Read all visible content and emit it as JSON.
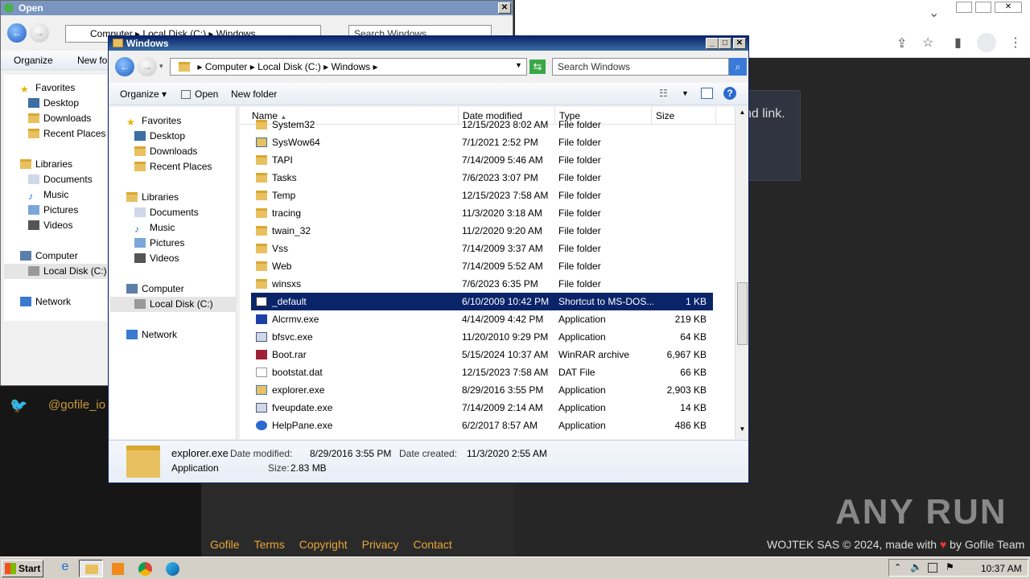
{
  "browser": {
    "partial_text": "nd link.",
    "social_handle": "@gofile_io",
    "footer_links": [
      "Gofile",
      "Terms",
      "Copyright",
      "Privacy",
      "Contact"
    ],
    "footer_right": "WOJTEK SAS © 2024, made with",
    "footer_by": "by Gofile Team",
    "watermark": "ANY RUN"
  },
  "open_dialog": {
    "title": "Open",
    "breadcrumb": [
      "Computer",
      "Local Disk (C:)",
      "Windows"
    ],
    "search_placeholder": "Search Windows",
    "organize": "Organize",
    "new_folder": "New fol",
    "nav": {
      "favorites": "Favorites",
      "fav_items": [
        "Desktop",
        "Downloads",
        "Recent Places"
      ],
      "libraries": "Libraries",
      "lib_items": [
        "Documents",
        "Music",
        "Pictures",
        "Videos"
      ],
      "computer": "Computer",
      "local_disk": "Local Disk (C:)",
      "network": "Network"
    }
  },
  "explorer": {
    "title": "Windows",
    "breadcrumb": [
      "Computer",
      "Local Disk (C:)",
      "Windows"
    ],
    "search_placeholder": "Search Windows",
    "toolbar": {
      "organize": "Organize",
      "open": "Open",
      "new_folder": "New folder"
    },
    "nav": {
      "favorites": "Favorites",
      "fav_items": [
        "Desktop",
        "Downloads",
        "Recent Places"
      ],
      "libraries": "Libraries",
      "lib_items": [
        "Documents",
        "Music",
        "Pictures",
        "Videos"
      ],
      "computer": "Computer",
      "local_disk": "Local Disk (C:)",
      "network": "Network"
    },
    "columns": [
      "Name",
      "Date modified",
      "Type",
      "Size"
    ],
    "rows": [
      {
        "name": "System32",
        "date": "12/15/2023 8:02 AM",
        "type": "File folder",
        "size": "",
        "icon": "folder"
      },
      {
        "name": "SysWow64",
        "date": "7/1/2021 2:52 PM",
        "type": "File folder",
        "size": "",
        "icon": "folder-link"
      },
      {
        "name": "TAPI",
        "date": "7/14/2009 5:46 AM",
        "type": "File folder",
        "size": "",
        "icon": "folder"
      },
      {
        "name": "Tasks",
        "date": "7/6/2023 3:07 PM",
        "type": "File folder",
        "size": "",
        "icon": "folder"
      },
      {
        "name": "Temp",
        "date": "12/15/2023 7:58 AM",
        "type": "File folder",
        "size": "",
        "icon": "folder"
      },
      {
        "name": "tracing",
        "date": "11/3/2020 3:18 AM",
        "type": "File folder",
        "size": "",
        "icon": "folder"
      },
      {
        "name": "twain_32",
        "date": "11/2/2020 9:20 AM",
        "type": "File folder",
        "size": "",
        "icon": "folder"
      },
      {
        "name": "Vss",
        "date": "7/14/2009 3:37 AM",
        "type": "File folder",
        "size": "",
        "icon": "folder"
      },
      {
        "name": "Web",
        "date": "7/14/2009 5:52 AM",
        "type": "File folder",
        "size": "",
        "icon": "folder"
      },
      {
        "name": "winsxs",
        "date": "7/6/2023 6:35 PM",
        "type": "File folder",
        "size": "",
        "icon": "folder"
      },
      {
        "name": "_default",
        "date": "6/10/2009 10:42 PM",
        "type": "Shortcut to MS-DOS...",
        "size": "1 KB",
        "icon": "shortcut",
        "selected": true
      },
      {
        "name": "Alcrmv.exe",
        "date": "4/14/2009 4:42 PM",
        "type": "Application",
        "size": "219 KB",
        "icon": "app-blue"
      },
      {
        "name": "bfsvc.exe",
        "date": "11/20/2010 9:29 PM",
        "type": "Application",
        "size": "64 KB",
        "icon": "app"
      },
      {
        "name": "Boot.rar",
        "date": "5/15/2024 10:37 AM",
        "type": "WinRAR archive",
        "size": "6,967 KB",
        "icon": "rar"
      },
      {
        "name": "bootstat.dat",
        "date": "12/15/2023 7:58 AM",
        "type": "DAT File",
        "size": "66 KB",
        "icon": "file"
      },
      {
        "name": "explorer.exe",
        "date": "8/29/2016 3:55 PM",
        "type": "Application",
        "size": "2,903 KB",
        "icon": "explorer"
      },
      {
        "name": "fveupdate.exe",
        "date": "7/14/2009 2:14 AM",
        "type": "Application",
        "size": "14 KB",
        "icon": "app"
      },
      {
        "name": "HelpPane.exe",
        "date": "6/2/2017 8:57 AM",
        "type": "Application",
        "size": "486 KB",
        "icon": "help"
      }
    ],
    "details": {
      "filename": "explorer.exe",
      "type": "Application",
      "date_modified_label": "Date modified:",
      "date_modified": "8/29/2016 3:55 PM",
      "size_label": "Size:",
      "size": "2.83 MB",
      "date_created_label": "Date created:",
      "date_created": "11/3/2020 2:55 AM"
    }
  },
  "taskbar": {
    "start": "Start",
    "clock": "10:37 AM"
  }
}
